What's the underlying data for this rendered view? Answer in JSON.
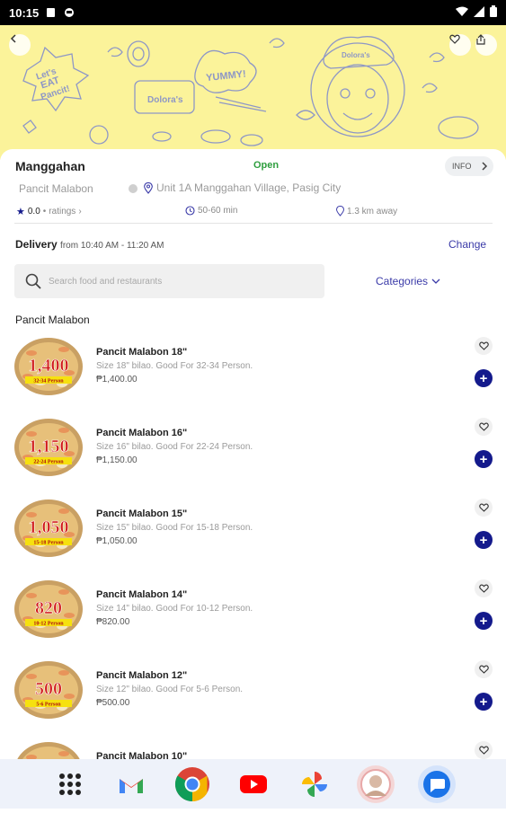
{
  "status_bar": {
    "time": "10:15"
  },
  "store": {
    "name": "Manggahan",
    "status": "Open",
    "info_label": "INFO",
    "cuisine": "Pancit Malabon",
    "address": "Unit 1A Manggahan Village, Pasig City",
    "rating": "0.0",
    "ratings_label": "ratings",
    "delivery_time": "50-60 min",
    "distance": "1.3 km away"
  },
  "banner": {
    "texts": [
      "Let's EAT Pancit!",
      "YUMMY!",
      "Dolora's",
      "Dolora's"
    ]
  },
  "delivery": {
    "label": "Delivery",
    "window": "from 10:40 AM - 11:20 AM",
    "change_label": "Change"
  },
  "search": {
    "placeholder": "Search food and restaurants",
    "value": ""
  },
  "categories_label": "Categories",
  "section_title": "Pancit Malabon",
  "menu_items": [
    {
      "name": "Pancit Malabon 18\"",
      "desc": "Size 18\" bilao. Good For 32-34 Person.",
      "price": "₱1,400.00",
      "badge_price": "1,400",
      "badge_people": "32-34 Person"
    },
    {
      "name": "Pancit Malabon 16\"",
      "desc": "Size 16\" bilao. Good For 22-24 Person.",
      "price": "₱1,150.00",
      "badge_price": "1,150",
      "badge_people": "22-24 Person"
    },
    {
      "name": "Pancit Malabon 15\"",
      "desc": "Size 15\" bilao. Good For 15-18 Person.",
      "price": "₱1,050.00",
      "badge_price": "1,050",
      "badge_people": "15-18 Person"
    },
    {
      "name": "Pancit Malabon 14\"",
      "desc": "Size 14\" bilao. Good For 10-12 Person.",
      "price": "₱820.00",
      "badge_price": "820",
      "badge_people": "10-12 Person"
    },
    {
      "name": "Pancit Malabon 12\"",
      "desc": "Size 12\" bilao. Good For 5-6 Person.",
      "price": "₱500.00",
      "badge_price": "500",
      "badge_people": "5-6 Person"
    },
    {
      "name": "Pancit Malabon 10\"",
      "desc": "",
      "price": "",
      "badge_price": "",
      "badge_people": ""
    }
  ],
  "dock": {
    "apps": [
      "app-drawer-icon",
      "gmail-icon",
      "chrome-icon",
      "youtube-icon",
      "photos-icon",
      "profile-avatar",
      "messages-icon"
    ]
  },
  "colors": {
    "banner_bg": "#fbf39a",
    "accent": "#3a3aa8",
    "add_button": "#141a8c",
    "open_green": "#2e9e3e"
  }
}
